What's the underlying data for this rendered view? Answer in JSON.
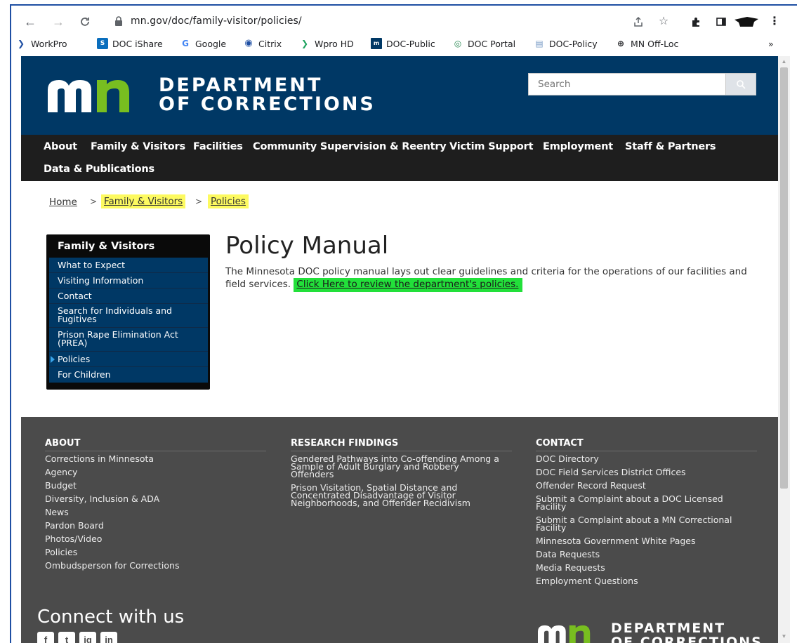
{
  "browser": {
    "url": "mn.gov/doc/family-visitor/policies/",
    "bookmarks": [
      {
        "label": "WorkPro",
        "icon": "chevron-right-icon"
      },
      {
        "label": "DOC iShare",
        "icon": "sharepoint-icon"
      },
      {
        "label": "Google",
        "icon": "google-icon"
      },
      {
        "label": "Citrix",
        "icon": "citrix-icon"
      },
      {
        "label": "Wpro HD",
        "icon": "chevron-right-icon"
      },
      {
        "label": "DOC-Public",
        "icon": "mn-icon"
      },
      {
        "label": "DOC Portal",
        "icon": "spiral-icon"
      },
      {
        "label": "DOC-Policy",
        "icon": "document-icon"
      },
      {
        "label": "MN Off-Loc",
        "icon": "globe-icon"
      }
    ],
    "more_bookmarks": "»"
  },
  "header": {
    "logo_line1": "DEPARTMENT",
    "logo_line2": "OF CORRECTIONS",
    "search_placeholder": "Search",
    "brand_blue": "#003865",
    "brand_green": "#78be20"
  },
  "nav": {
    "items": [
      "About",
      "Family & Visitors",
      "Facilities",
      "Community Supervision & Reentry",
      "Victim Support",
      "Employment",
      "Staff & Partners",
      "Data & Publications"
    ]
  },
  "breadcrumb": {
    "items": [
      "Home",
      "Family & Visitors",
      "Policies"
    ],
    "separator": ">"
  },
  "sidebar": {
    "title": "Family & Visitors",
    "items": [
      {
        "label": "What to Expect"
      },
      {
        "label": "Visiting Information"
      },
      {
        "label": "Contact"
      },
      {
        "label": "Search for Individuals and Fugitives"
      },
      {
        "label": "Prison Rape Elimination Act (PREA)"
      },
      {
        "label": "Policies",
        "active": true
      },
      {
        "label": "For Children"
      }
    ]
  },
  "main": {
    "title": "Policy Manual",
    "intro": "The Minnesota DOC policy manual lays out clear guidelines and criteria for the operations of our facilities and field services.",
    "link_text": "Click Here to review the department's policies."
  },
  "footer": {
    "about": {
      "heading": "ABOUT",
      "links": [
        "Corrections in Minnesota",
        "Agency",
        "Budget",
        "Diversity, Inclusion & ADA",
        "News",
        "Pardon Board",
        "Photos/Video",
        "Policies",
        "Ombudsperson for Corrections"
      ]
    },
    "research": {
      "heading": "RESEARCH FINDINGS",
      "links": [
        "Gendered Pathways into Co-offending Among a Sample of Adult Burglary and Robbery Offenders",
        "Prison Visitation, Spatial Distance and Concentrated Disadvantage of Visitor Neighborhoods, and Offender Recidivism"
      ]
    },
    "contact": {
      "heading": "CONTACT",
      "links": [
        "DOC Directory",
        "DOC Field Services District Offices",
        "Offender Record Request",
        "Submit a Complaint about a DOC Licensed Facility",
        "Submit a Complaint about a MN Correctional Facility",
        "Minnesota Government White Pages",
        "Data Requests",
        "Media Requests",
        "Employment Questions"
      ]
    },
    "connect": "Connect with us",
    "social": [
      "f",
      "t",
      "ig",
      "in"
    ],
    "logo_line1": "DEPARTMENT",
    "logo_line2": "OF CORRECTIONS"
  }
}
